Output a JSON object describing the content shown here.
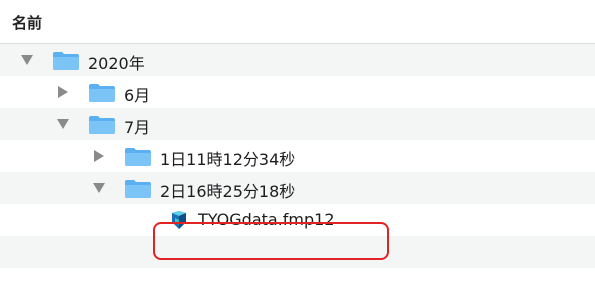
{
  "header": {
    "name_column_label": "名前"
  },
  "rows": [
    {
      "label": "2020年",
      "kind": "folder",
      "expanded": true,
      "icon": "folder-icon"
    },
    {
      "label": "6月",
      "kind": "folder",
      "expanded": false,
      "icon": "folder-icon"
    },
    {
      "label": "7月",
      "kind": "folder",
      "expanded": true,
      "icon": "folder-icon"
    },
    {
      "label": "1日11時12分34秒",
      "kind": "folder",
      "expanded": false,
      "icon": "folder-icon"
    },
    {
      "label": "2日16時25分18秒",
      "kind": "folder",
      "expanded": true,
      "icon": "folder-icon"
    },
    {
      "label": "TYOGdata.fmp12",
      "kind": "file",
      "icon": "filemaker-file-icon"
    }
  ],
  "colors": {
    "folder": "#5ab0f0",
    "folder_tab": "#7cc3f6",
    "highlight": "#e02424",
    "disclosure": "#8a8a8a",
    "alt_row": "#f4f5f5"
  }
}
